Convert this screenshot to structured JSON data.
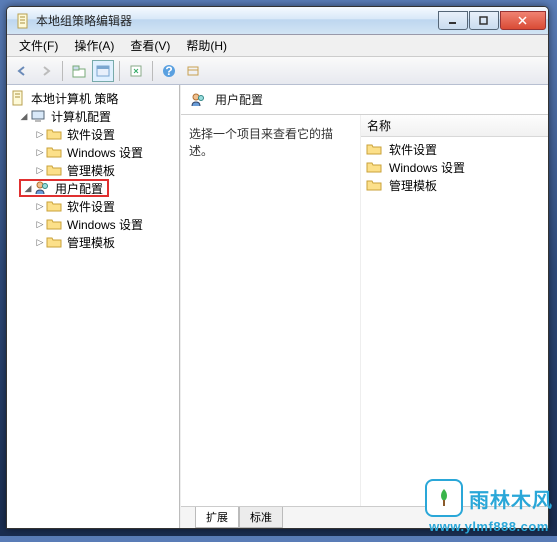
{
  "title": "本地组策略编辑器",
  "menu": {
    "file": "文件(F)",
    "action": "操作(A)",
    "view": "查看(V)",
    "help": "帮助(H)"
  },
  "tree": {
    "root": "本地计算机 策略",
    "computer": "计算机配置",
    "user": "用户配置",
    "software": "软件设置",
    "windows": "Windows 设置",
    "admin": "管理模板"
  },
  "right": {
    "header": "用户配置",
    "desc": "选择一个项目来查看它的描述。",
    "col_name": "名称",
    "items": {
      "software": "软件设置",
      "windows": "Windows 设置",
      "admin": "管理模板"
    }
  },
  "tabs": {
    "ext": "扩展",
    "std": "标准"
  },
  "watermark": {
    "brand": "雨林木风",
    "url": "www.ylmf888.com"
  }
}
